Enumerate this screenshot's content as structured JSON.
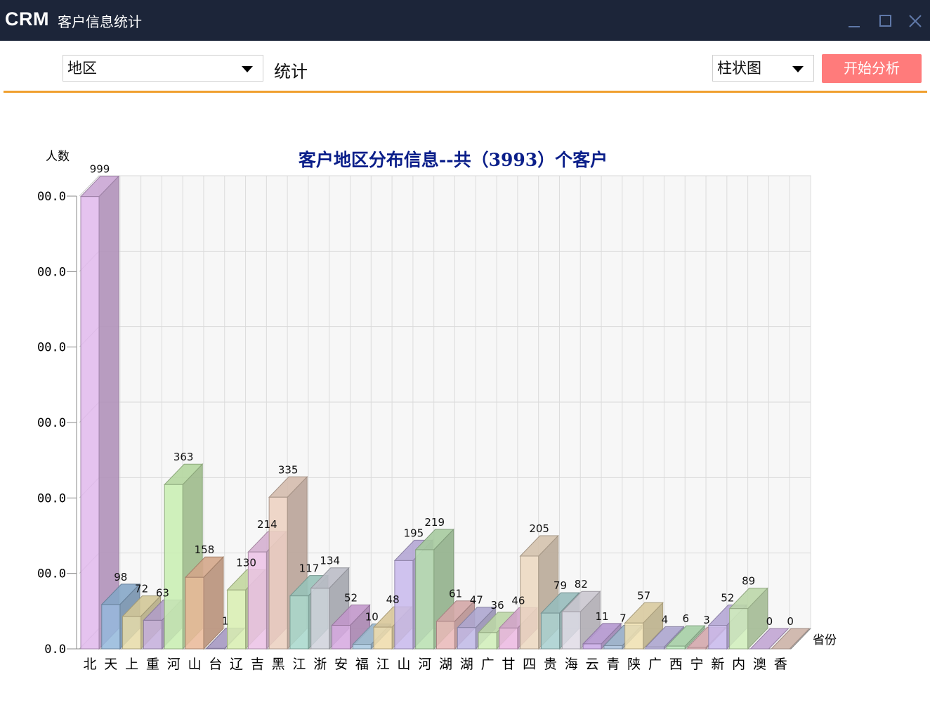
{
  "window": {
    "logo": "CRM",
    "title": "客户信息统计",
    "minimize_icon": "minimize-icon",
    "maximize_icon": "maximize-icon",
    "close_icon": "close-icon"
  },
  "toolbar": {
    "group_select": "地区",
    "stat_label": "统计",
    "chart_type_select": "柱状图",
    "analyze_button": "开始分析",
    "accent_color": "#f0a030",
    "button_color": "#ff7b7b"
  },
  "chart_data": {
    "type": "bar",
    "title": "客户地区分布信息--共（3993）个客户",
    "ylabel": "人数",
    "xlabel": "省份",
    "ylim": [
      0,
      1000
    ],
    "yticks": [
      "0.0",
      "00.0",
      "00.0",
      "00.0",
      "00.0",
      "00.0",
      "00.0"
    ],
    "grid": true,
    "categories": [
      "北",
      "天",
      "上",
      "重",
      "河",
      "山",
      "台",
      "辽",
      "吉",
      "黑",
      "江",
      "浙",
      "安",
      "福",
      "江",
      "山",
      "河",
      "湖",
      "湖",
      "广",
      "甘",
      "四",
      "贵",
      "海",
      "云",
      "青",
      "陕",
      "广",
      "西",
      "宁",
      "新",
      "内",
      "澳",
      "香"
    ],
    "values": [
      999,
      98,
      72,
      63,
      363,
      158,
      1,
      130,
      214,
      335,
      117,
      134,
      52,
      10,
      48,
      195,
      219,
      61,
      47,
      36,
      46,
      205,
      79,
      82,
      11,
      7,
      57,
      4,
      6,
      3,
      52,
      89,
      0,
      0
    ],
    "colors": [
      "#e0b8ec",
      "#94b8dc",
      "#e8dca8",
      "#c4aedc",
      "#c8eeb0",
      "#eab898",
      "#b8aad8",
      "#d8eeb0",
      "#ecc2e6",
      "#ecd0c0",
      "#a8d8cc",
      "#d0d2dc",
      "#d6a8e0",
      "#a8c8e0",
      "#f0dcaa",
      "#c8b8ec",
      "#b8e0b0",
      "#eab8b8",
      "#c0b8e6",
      "#d0eeb8",
      "#ecb8e2",
      "#ecd8c0",
      "#a8d0d0",
      "#e0dce6",
      "#c8a8e6",
      "#a8c0dc",
      "#f0e0b0",
      "#c0b8e6",
      "#b8e6b8",
      "#ecbcc0",
      "#c8b8ec",
      "#d0eebb",
      "#d8b8ec",
      "#e4c8bc"
    ]
  }
}
